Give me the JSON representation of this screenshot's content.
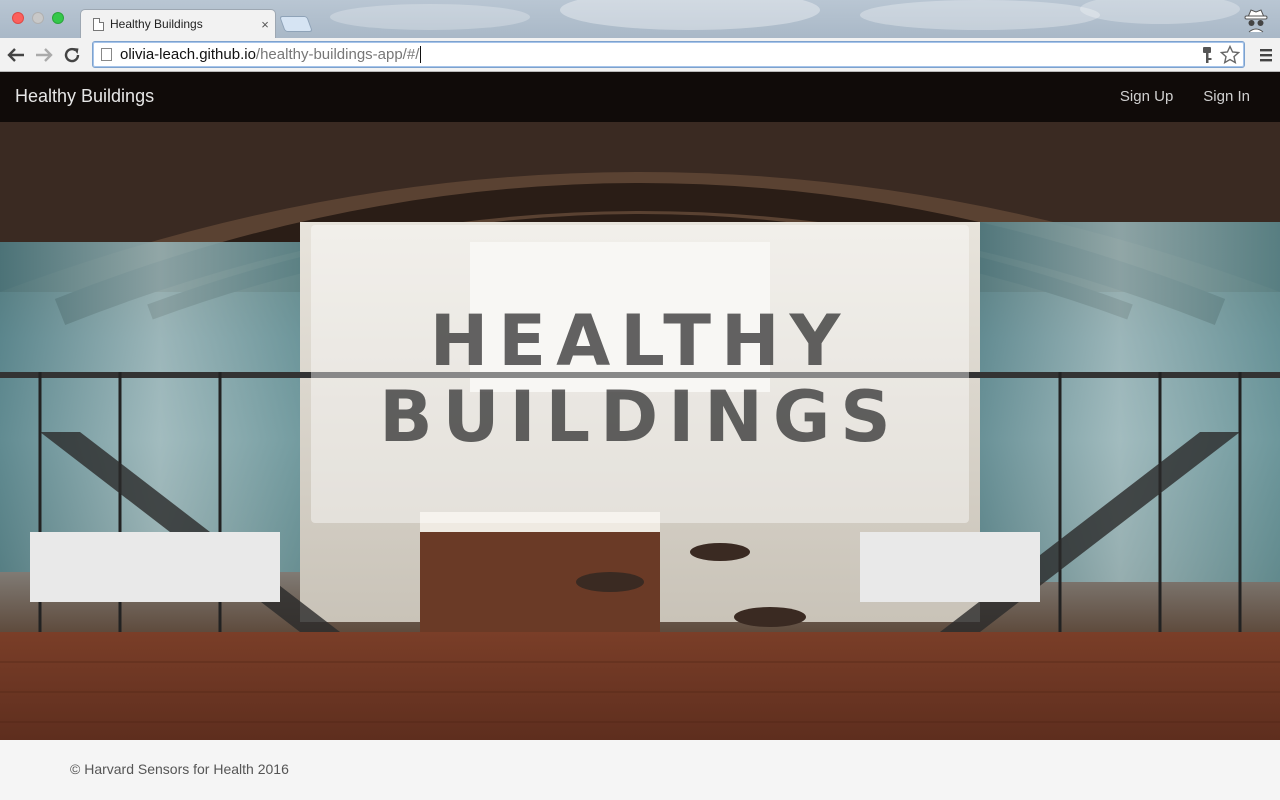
{
  "browser": {
    "tab_title": "Healthy Buildings",
    "tab_close": "×",
    "url_host": "olivia-leach.github.io",
    "url_path": "/healthy-buildings-app/#/"
  },
  "navbar": {
    "brand": "Healthy Buildings",
    "links": [
      {
        "label": "Sign Up"
      },
      {
        "label": "Sign In"
      }
    ]
  },
  "hero": {
    "title_line1": "HEALTHY",
    "title_line2": "BUILDINGS"
  },
  "footer": {
    "text": "© Harvard Sensors for Health 2016"
  },
  "colors": {
    "navbar_bg": "#000000",
    "footer_bg": "#f5f5f5",
    "omnibox_border": "#7da2ce"
  },
  "icons": [
    "page-icon",
    "back-arrow-icon",
    "forward-arrow-icon",
    "reload-icon",
    "key-icon",
    "star-icon",
    "menu-icon",
    "incognito-icon"
  ]
}
